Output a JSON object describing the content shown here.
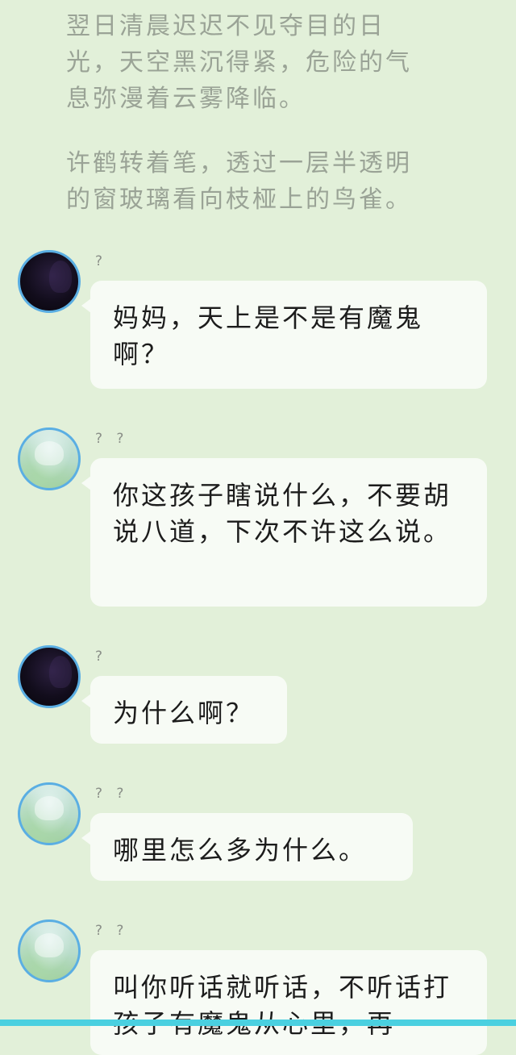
{
  "narration": [
    "翌日清晨迟迟不见夺目的日光，天空黑沉得紧，危险的气息弥漫着云雾降临。",
    "许鹤转着笔，透过一层半透明的窗玻璃看向枝桠上的鸟雀。"
  ],
  "messages": [
    {
      "sender": "?",
      "avatar": "dark-avatar",
      "text": "妈妈，天上是不是有魔鬼啊？"
    },
    {
      "sender": "? ?",
      "avatar": "light-avatar",
      "text": "你这孩子瞎说什么，不要胡说八道，下次不许这么说。"
    },
    {
      "sender": "?",
      "avatar": "dark-avatar",
      "text": "为什么啊？"
    },
    {
      "sender": "? ?",
      "avatar": "light-avatar",
      "text": "哪里怎么多为什么。"
    },
    {
      "sender": "? ?",
      "avatar": "light-avatar",
      "text": "叫你听话就听话，不听话打孩子有魔鬼从心里，再"
    }
  ],
  "colors": {
    "background": "#e2f0d9",
    "bubble": "#f7fbf5",
    "avatar_ring": "#5aaee3",
    "bottom_bar": "#4ad0e0"
  }
}
